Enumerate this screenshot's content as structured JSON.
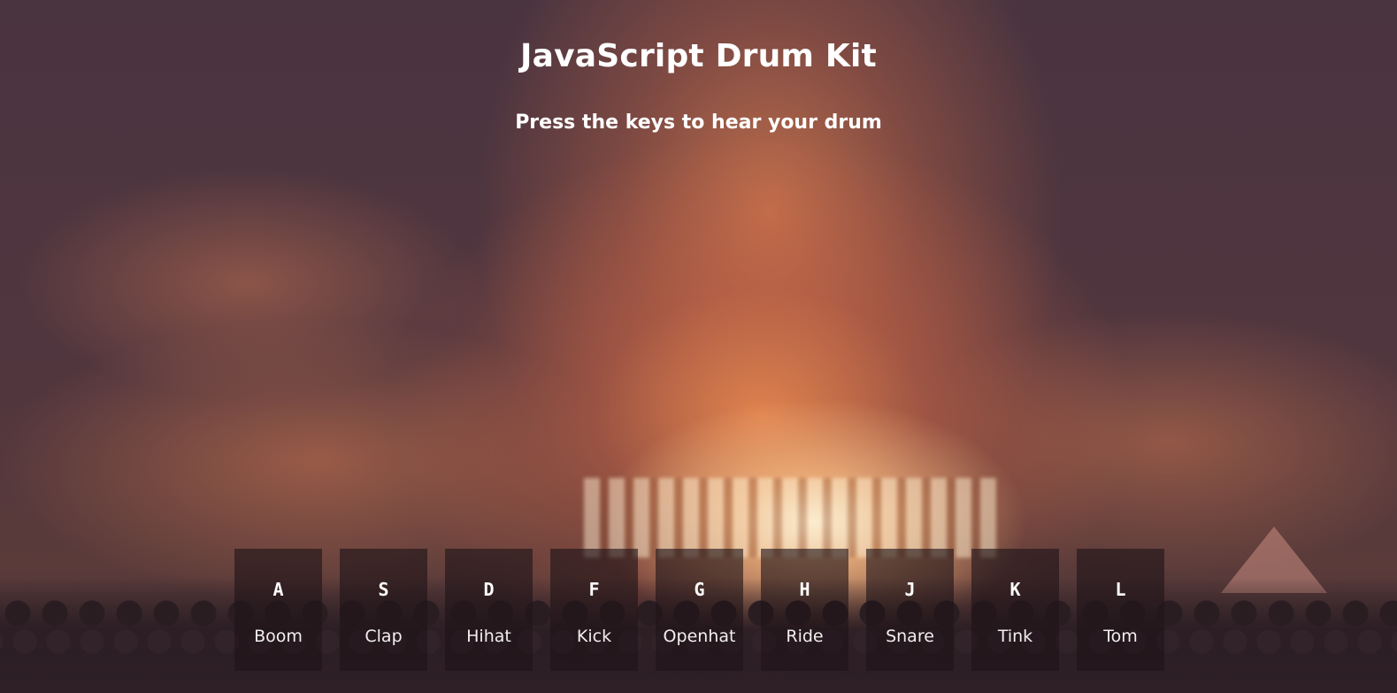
{
  "header": {
    "title": "JavaScript Drum Kit",
    "subtitle": "Press the keys to hear your drum"
  },
  "keys": [
    {
      "letter": "A",
      "sound": "Boom"
    },
    {
      "letter": "S",
      "sound": "Clap"
    },
    {
      "letter": "D",
      "sound": "Hihat"
    },
    {
      "letter": "F",
      "sound": "Kick"
    },
    {
      "letter": "G",
      "sound": "Openhat"
    },
    {
      "letter": "H",
      "sound": "Ride"
    },
    {
      "letter": "J",
      "sound": "Snare"
    },
    {
      "letter": "K",
      "sound": "Tink"
    },
    {
      "letter": "L",
      "sound": "Tom"
    }
  ],
  "background": {
    "image": "concert-crowd-stage-lights",
    "tint": "#4a3540",
    "accent": "#f08a50"
  }
}
